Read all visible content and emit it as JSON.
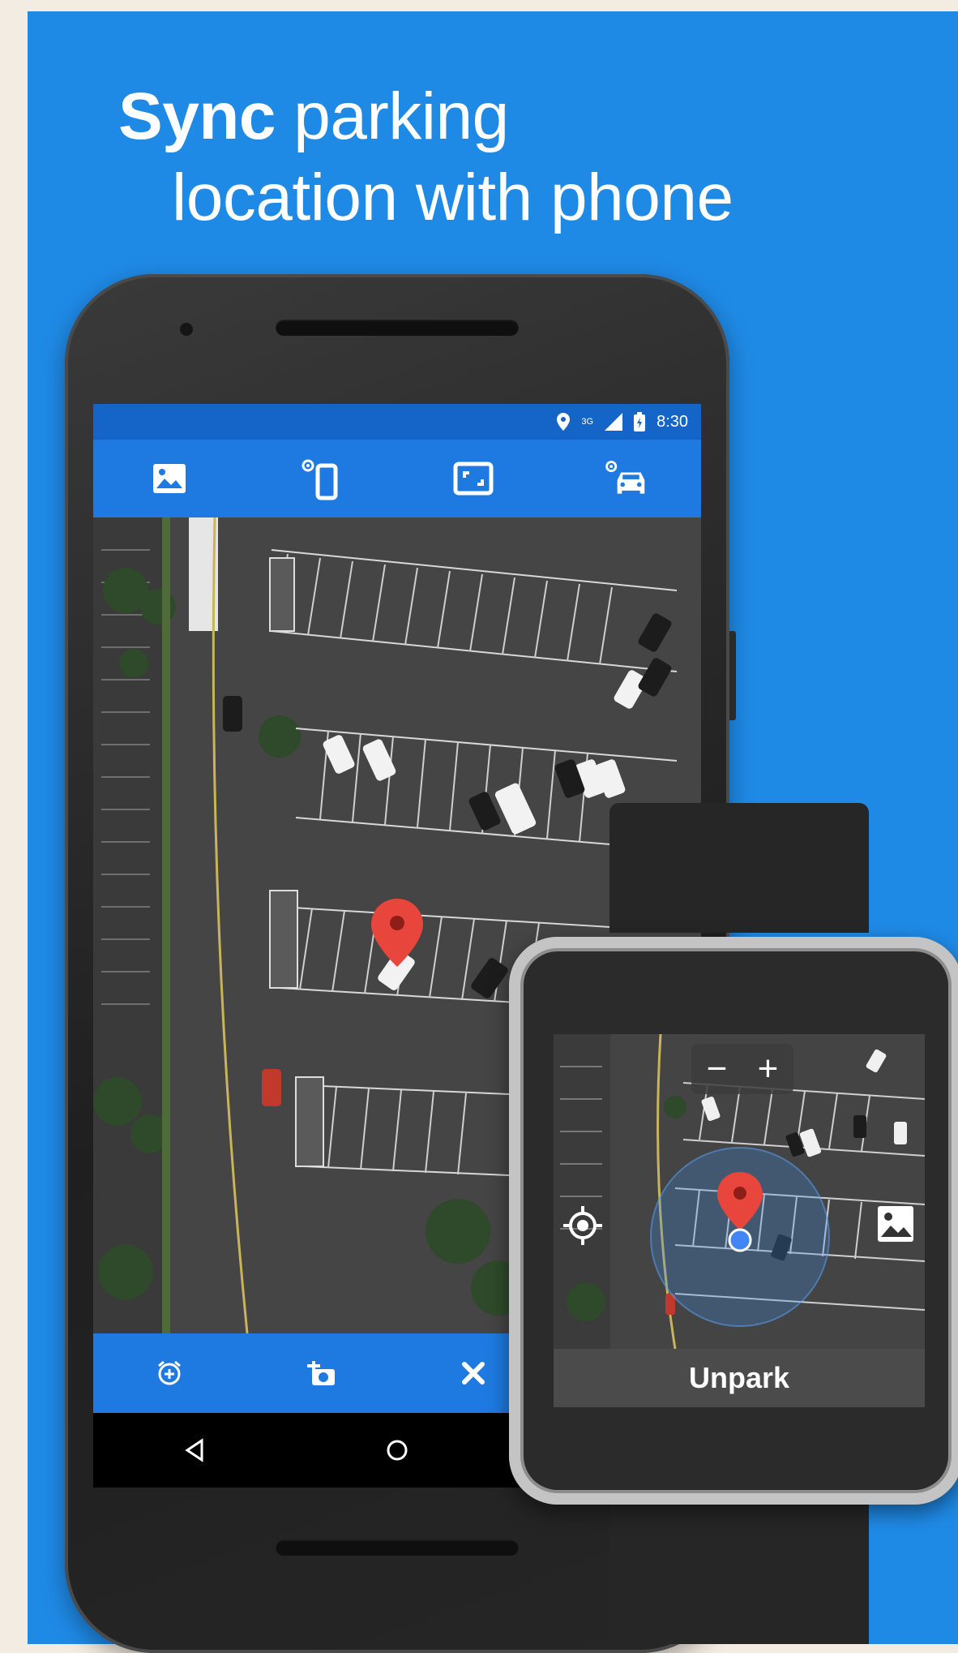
{
  "headline": {
    "bold": "Sync",
    "line1_rest": " parking",
    "line2": "location with phone"
  },
  "phone": {
    "status": {
      "time": "8:30",
      "signal": "3G"
    },
    "toolbar_icons": [
      "photo-icon",
      "find-phone-icon",
      "fullscreen-icon",
      "car-location-icon"
    ],
    "bottom_icons": [
      "add-alarm-icon",
      "add-photo-icon",
      "close-icon"
    ],
    "nav_icons": [
      "back-icon",
      "home-icon"
    ]
  },
  "watch": {
    "zoom_out": "−",
    "zoom_in": "+",
    "unpark_label": "Unpark"
  },
  "colors": {
    "brand": "#1f8ae6",
    "toolbar": "#1e7ae0",
    "statusbar": "#1565c9",
    "pin": "#e8453c"
  }
}
